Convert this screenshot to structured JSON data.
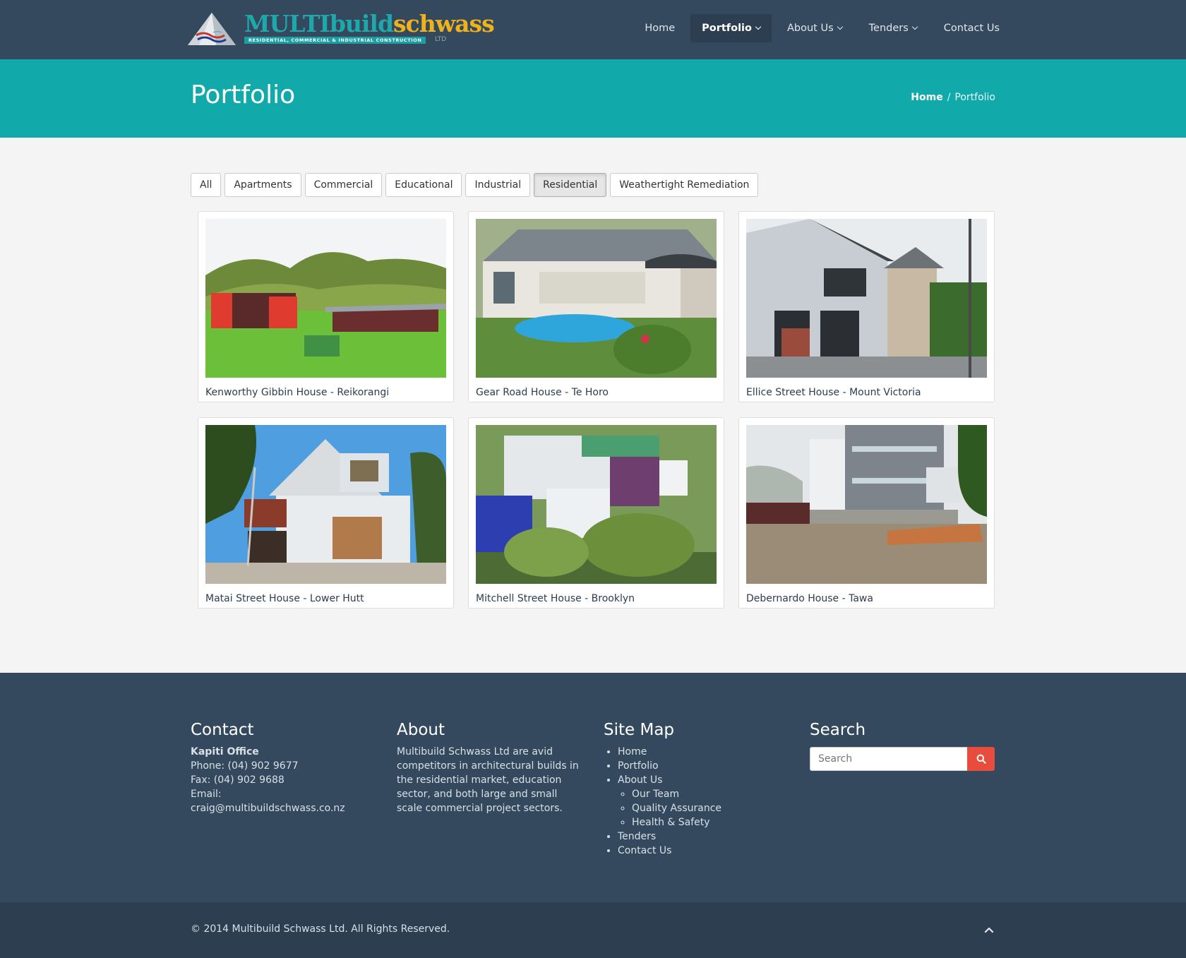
{
  "brand": {
    "name_part1": "MULTIbuild",
    "name_part2": "schwass",
    "tagline": "RESIDENTIAL, COMMERCIAL & INDUSTRIAL CONSTRUCTION",
    "suffix": "LTD"
  },
  "nav": {
    "items": [
      {
        "label": "Home"
      },
      {
        "label": "Portfolio"
      },
      {
        "label": "About Us"
      },
      {
        "label": "Tenders"
      },
      {
        "label": "Contact Us"
      }
    ]
  },
  "page": {
    "title": "Portfolio",
    "breadcrumb": {
      "home": "Home",
      "separator": "/",
      "current": "Portfolio"
    }
  },
  "filters": [
    "All",
    "Apartments",
    "Commercial",
    "Educational",
    "Industrial",
    "Residential",
    "Weathertight Remediation"
  ],
  "active_filter": "Residential",
  "portfolio": [
    {
      "title": "Kenworthy Gibbin House - Reikorangi"
    },
    {
      "title": "Gear Road House - Te Horo"
    },
    {
      "title": "Ellice Street House - Mount Victoria"
    },
    {
      "title": "Matai Street House - Lower Hutt"
    },
    {
      "title": "Mitchell Street House - Brooklyn"
    },
    {
      "title": "Debernardo House - Tawa"
    }
  ],
  "footer": {
    "contact": {
      "heading": "Contact",
      "office": "Kapiti Office",
      "phone": "Phone: (04) 902 9677",
      "fax": "Fax: (04) 902 9688",
      "email": "Email: craig@multibuildschwass.co.nz"
    },
    "about": {
      "heading": "About",
      "text": "Multibuild Schwass Ltd are avid competitors in architectural builds in the residential market, education sector, and both large and small scale commercial project sectors."
    },
    "sitemap": {
      "heading": "Site Map",
      "home": "Home",
      "portfolio": "Portfolio",
      "about": "About Us",
      "our_team": "Our Team",
      "quality": "Quality Assurance",
      "health": "Health & Safety",
      "tenders": "Tenders",
      "contact": "Contact Us"
    },
    "search": {
      "heading": "Search",
      "placeholder": "Search"
    },
    "copyright": "© 2014 Multibuild Schwass Ltd. All Rights Reserved."
  },
  "colors": {
    "header_bg": "#34495e",
    "accent_teal": "#12a9ab",
    "search_button": "#e74c3c"
  }
}
